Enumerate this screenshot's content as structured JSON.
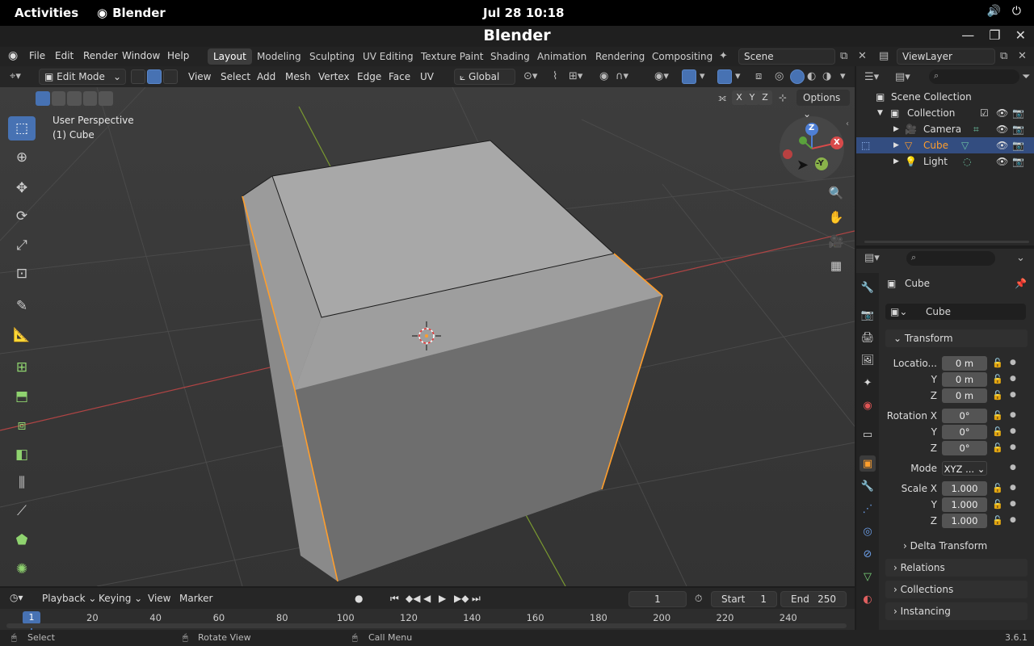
{
  "system": {
    "activities": "Activities",
    "app_name": "Blender",
    "clock": "Jul 28  10:18"
  },
  "window": {
    "title": "Blender"
  },
  "menubar": {
    "items": [
      "File",
      "Edit",
      "Render",
      "Window",
      "Help"
    ],
    "workspaces": [
      "Layout",
      "Modeling",
      "Sculpting",
      "UV Editing",
      "Texture Paint",
      "Shading",
      "Animation",
      "Rendering",
      "Compositing"
    ],
    "active_workspace": "Layout",
    "scene": "Scene",
    "view_layer": "ViewLayer"
  },
  "viewport_header": {
    "mode": "Edit Mode",
    "menus": [
      "View",
      "Select",
      "Add",
      "Mesh",
      "Vertex",
      "Edge",
      "Face",
      "UV"
    ],
    "orientation": "Global",
    "axes": [
      "X",
      "Y",
      "Z"
    ],
    "options": "Options"
  },
  "viewport": {
    "perspective": "User Perspective",
    "object": "(1) Cube",
    "gizmo": {
      "z": "Z",
      "x": "X",
      "y": "-Y"
    },
    "accent": "#ff9e2c"
  },
  "timeline": {
    "menus": [
      "Playback",
      "Keying",
      "View",
      "Marker"
    ],
    "current_frame": "1",
    "start_label": "Start",
    "start": "1",
    "end_label": "End",
    "end": "250",
    "frame_badge": "1",
    "ticks": [
      "20",
      "40",
      "60",
      "80",
      "100",
      "120",
      "140",
      "160",
      "180",
      "200",
      "220",
      "240"
    ]
  },
  "statusbar": {
    "select": "Select",
    "rotate": "Rotate View",
    "call_menu": "Call Menu",
    "version": "3.6.1"
  },
  "outliner": {
    "scene_collection": "Scene Collection",
    "collection": "Collection",
    "items": [
      {
        "name": "Camera"
      },
      {
        "name": "Cube"
      },
      {
        "name": "Light"
      }
    ]
  },
  "properties": {
    "object_name": "Cube",
    "data_name": "Cube",
    "transform_label": "Transform",
    "location_label": "Locatio...",
    "rotation_label": "Rotation X",
    "mode_label": "Mode",
    "scale_label": "Scale X",
    "y": "Y",
    "z": "Z",
    "location": [
      "0 m",
      "0 m",
      "0 m"
    ],
    "rotation": [
      "0°",
      "0°",
      "0°"
    ],
    "mode": "XYZ ...",
    "scale": [
      "1.000",
      "1.000",
      "1.000"
    ],
    "delta_transform": "Delta Transform",
    "relations": "Relations",
    "collections": "Collections",
    "instancing": "Instancing"
  }
}
